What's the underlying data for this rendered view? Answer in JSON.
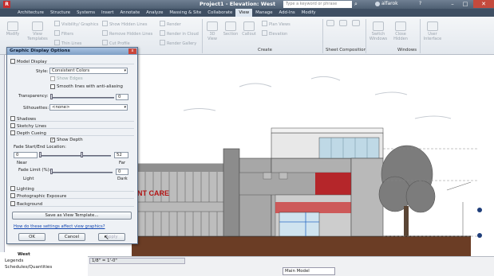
{
  "titlebar": {
    "title": "Project1 - Elevation: West",
    "search_placeholder": "Type a keyword or phrase",
    "user": "alfarok",
    "help": "?",
    "minimize": "–",
    "maximize": "□",
    "close": "✕"
  },
  "tabs": [
    "Architecture",
    "Structure",
    "Systems",
    "Insert",
    "Annotate",
    "Analyze",
    "Massing & Site",
    "Collaborate",
    "View",
    "Manage",
    "Add-Ins",
    "Modify"
  ],
  "active_tab": "View",
  "ribbon": {
    "modify": "Modify",
    "view_templates": "View Templates",
    "visibility": "Visibility/ Graphics",
    "filters": "Filters",
    "thin_lines": "Thin Lines",
    "show_hidden": "Show Hidden Lines",
    "remove_hidden": "Remove Hidden Lines",
    "cut_profile": "Cut Profile",
    "render": "Render",
    "render_cloud": "Render in Cloud",
    "render_gallery": "Render Gallery",
    "view_3d": "3D View",
    "section": "Section",
    "callout": "Callout",
    "plan_views": "Plan Views",
    "elevation": "Elevation",
    "group_create": "Create",
    "group_sheet": "Sheet Composition",
    "group_windows": "Windows",
    "switch_windows": "Switch Windows",
    "close_hidden": "Close Hidden",
    "user_interface": "User Interface"
  },
  "dialog": {
    "title": "Graphic Display Options",
    "close": "x",
    "model_display": "Model Display",
    "style_label": "Style:",
    "style_value": "Consistent Colors",
    "show_edges": "Show Edges",
    "smooth_lines": "Smooth lines with anti-aliasing",
    "transparency_label": "Transparency:",
    "transparency_value": "0",
    "silhouettes_label": "Silhouettes:",
    "silhouettes_value": "<none>",
    "shadows": "Shadows",
    "sketchy_lines": "Sketchy Lines",
    "depth_cueing": "Depth Cueing",
    "show_depth": "Show Depth",
    "fade_start_end": "Fade Start/End Location:",
    "fade_start_value": "0",
    "fade_end_value": "52",
    "near": "Near",
    "far": "Far",
    "fade_limit_label": "Fade Limit (%):",
    "fade_limit_value": "0",
    "light": "Light",
    "dark": "Dark",
    "lighting": "Lighting",
    "photographic_exposure": "Photographic Exposure",
    "background": "Background",
    "save_template": "Save as View Template...",
    "help_link": "How do these settings affect view graphics?",
    "ok": "OK",
    "cancel": "Cancel",
    "apply": "Apply"
  },
  "project_browser": {
    "west": "West",
    "legends": "Legends",
    "schedules": "Schedules/Quantities"
  },
  "status": {
    "view_scale": "1/8\" = 1'-0\"",
    "main_model": "Main Model"
  },
  "building": {
    "sign": "NT CARE"
  },
  "colors": {
    "accent": "#3f4f63",
    "sign_red": "#b41414",
    "dialog_title": "#8aa8cd"
  }
}
